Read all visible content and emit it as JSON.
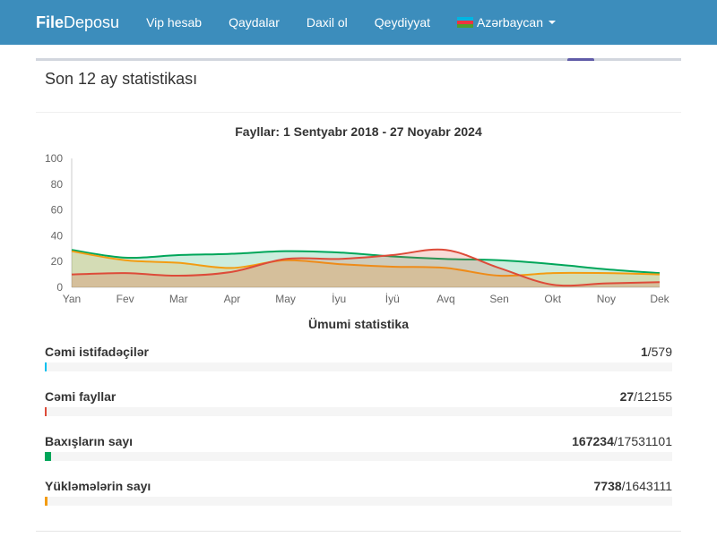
{
  "navbar": {
    "brand_bold": "File",
    "brand_rest": "Deposu",
    "items": [
      "Vip hesab",
      "Qaydalar",
      "Daxil ol",
      "Qeydiyyat"
    ],
    "language": "Azərbaycan"
  },
  "panel": {
    "title": "Son 12 ay statistikası",
    "stats_title": "Ümumi statistika"
  },
  "chart_data": {
    "type": "area",
    "title": "Fayllar: 1 Sentyabr 2018 - 27 Noyabr 2024",
    "categories": [
      "Yan",
      "Fev",
      "Mar",
      "Apr",
      "May",
      "İyu",
      "İyü",
      "Avq",
      "Sen",
      "Okt",
      "Noy",
      "Dek"
    ],
    "yticks": [
      0,
      20,
      40,
      60,
      80,
      100
    ],
    "ylim": [
      0,
      100
    ],
    "series": [
      {
        "color": "#00a65a",
        "fill": "rgba(0,166,90,0.2)",
        "values": [
          29,
          23,
          25,
          26,
          28,
          27,
          24,
          22,
          21,
          18,
          14,
          11
        ]
      },
      {
        "color": "#f39c12",
        "fill": "rgba(243,156,18,0.2)",
        "values": [
          28,
          21,
          19,
          15,
          21,
          18,
          16,
          15,
          9,
          11,
          11,
          10
        ]
      },
      {
        "color": "#dd4b39",
        "fill": "rgba(221,75,57,0.2)",
        "values": [
          10,
          11,
          9,
          12,
          22,
          22,
          25,
          29,
          15,
          2,
          3,
          4
        ]
      }
    ]
  },
  "stats": [
    {
      "label": "Cəmi istifadəçilər",
      "bold": "1",
      "rest": "/579",
      "color": "#00c0ef",
      "fraction": 0.002
    },
    {
      "label": "Cəmi fayllar",
      "bold": "27",
      "rest": "/12155",
      "color": "#dd4b39",
      "fraction": 0.002
    },
    {
      "label": "Baxışların sayı",
      "bold": "167234",
      "rest": "/17531101",
      "color": "#00a65a",
      "fraction": 0.0095
    },
    {
      "label": "Yükləmələrin sayı",
      "bold": "7738",
      "rest": "/1643111",
      "color": "#f39c12",
      "fraction": 0.0047
    }
  ]
}
